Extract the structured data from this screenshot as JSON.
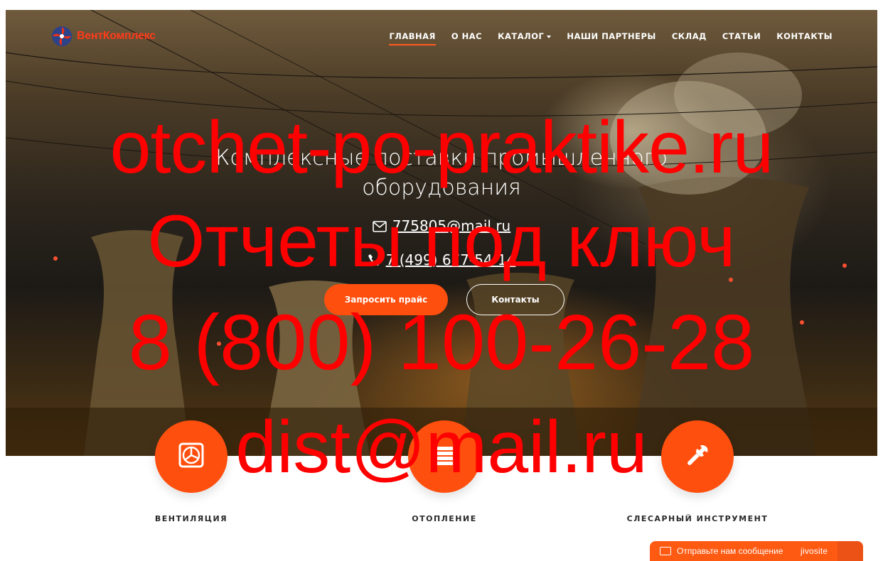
{
  "brand": {
    "name": "ВентКомплекс"
  },
  "nav": {
    "items": [
      {
        "label": "ГЛАВНАЯ",
        "active": true
      },
      {
        "label": "О НАС"
      },
      {
        "label": "КАТАЛОГ",
        "dropdown": true
      },
      {
        "label": "НАШИ ПАРТНЕРЫ"
      },
      {
        "label": "СКЛАД"
      },
      {
        "label": "СТАТЬИ"
      },
      {
        "label": "КОНТАКТЫ"
      }
    ]
  },
  "hero": {
    "title_line1": "Комплексные поставки промышленного",
    "title_line2": "оборудования",
    "email": "775805@mail.ru",
    "phone": "7 (499) 677-54-14",
    "btn_price": "Запросить прайс",
    "btn_contacts": "Контакты"
  },
  "watermark": {
    "line1": "otchet-po-praktike.ru",
    "line2": "Отчеты под ключ",
    "line3": "8 (800) 100-26-28",
    "line4": "dist@mail.ru"
  },
  "features": [
    {
      "label": "ВЕНТИЛЯЦИЯ",
      "icon": "ventilation-icon"
    },
    {
      "label": "ОТОПЛЕНИЕ",
      "icon": "radiator-icon"
    },
    {
      "label": "СЛЕСАРНЫЙ ИНСТРУМЕНТ",
      "icon": "wrench-icon"
    }
  ],
  "chat": {
    "text": "Отправьте нам сообщение",
    "brand": "jivosite"
  },
  "colors": {
    "accent": "#ff4f0e",
    "watermark": "#ff0000",
    "text_dark": "#2a2a2a"
  }
}
